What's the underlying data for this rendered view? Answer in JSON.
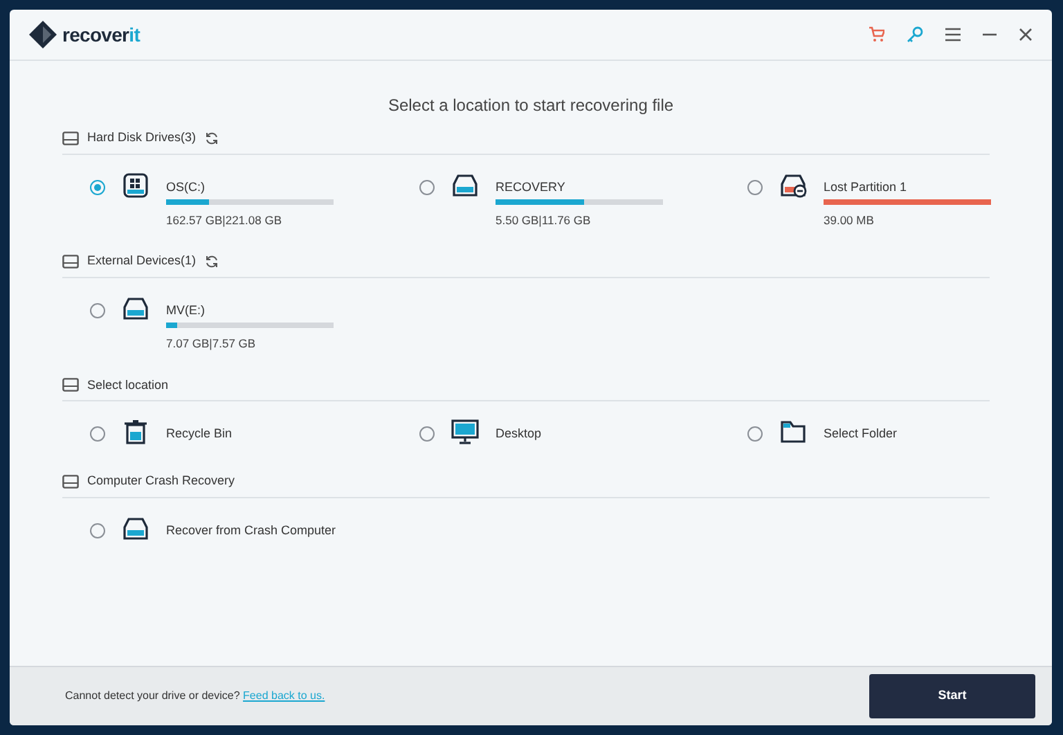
{
  "app": {
    "name_main": "recover",
    "name_accent": "it"
  },
  "heading": "Select a location to start recovering file",
  "sections": [
    {
      "title": "Hard Disk Drives(3)",
      "refresh": true,
      "items": [
        {
          "kind": "system-drive",
          "label": "OS(C:)",
          "selected": true,
          "level": 0.26,
          "color": "#1ba7d0",
          "size": "162.57  GB|221.08  GB"
        },
        {
          "kind": "drive",
          "label": "RECOVERY",
          "selected": false,
          "level": 0.53,
          "color": "#1ba7d0",
          "size": "5.50  GB|11.76  GB"
        },
        {
          "kind": "lost-partition",
          "label": "Lost Partition 1",
          "selected": false,
          "level": 1,
          "color": "#e8654f",
          "size": "39.00  MB"
        }
      ]
    },
    {
      "title": "External Devices(1)",
      "refresh": true,
      "items": [
        {
          "kind": "drive",
          "label": "MV(E:)",
          "selected": false,
          "level": 0.07,
          "color": "#1ba7d0",
          "size": "7.07  GB|7.57  GB"
        }
      ]
    },
    {
      "title": "Select location",
      "refresh": false,
      "items": [
        {
          "kind": "recycle-bin",
          "label": "Recycle Bin",
          "selected": false
        },
        {
          "kind": "desktop",
          "label": "Desktop",
          "selected": false
        },
        {
          "kind": "folder",
          "label": "Select Folder",
          "selected": false
        }
      ]
    },
    {
      "title": "Computer Crash Recovery",
      "refresh": false,
      "items": [
        {
          "kind": "crash-drive",
          "label": "Recover from Crash Computer",
          "selected": false
        }
      ]
    }
  ],
  "footer": {
    "prompt": "Cannot detect your drive or device?",
    "link": "Feed back to us."
  },
  "start_button": "Start"
}
